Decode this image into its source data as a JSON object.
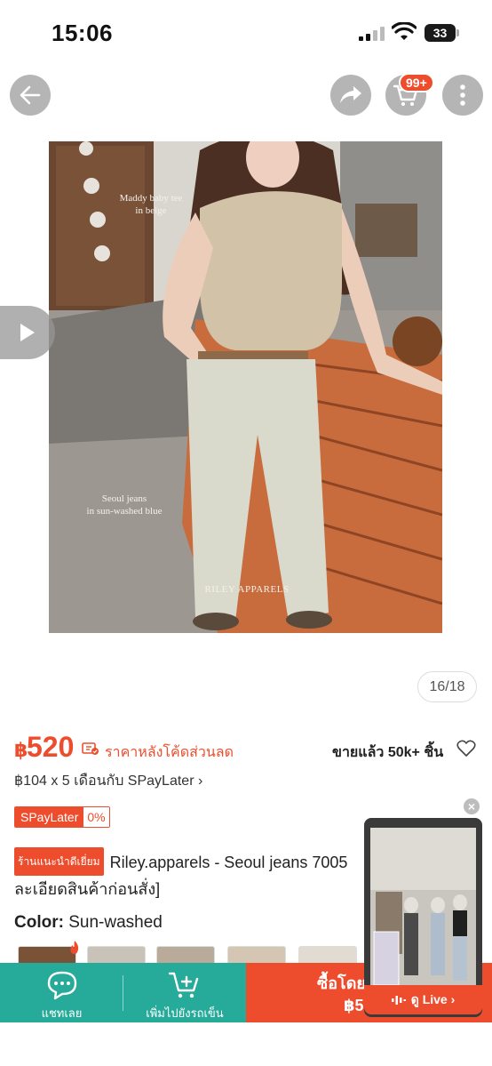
{
  "status_bar": {
    "time": "15:06",
    "battery": "33"
  },
  "header": {
    "cart_badge": "99+"
  },
  "product_image": {
    "caption_top_1": "Maddy baby tee",
    "caption_top_2": "in beige",
    "caption_mid_1": "Seoul jeans",
    "caption_mid_2": "in sun-washed blue",
    "watermark": "RILEY APPARELS",
    "counter": "16/18"
  },
  "price": {
    "currency": "฿",
    "value": "520",
    "note": "ราคาหลังโค้ดส่วนลด",
    "sold": "ขายแล้ว 50k+ ชิ้น",
    "installment": "฿104 x 5 เดือนกับ SPayLater ›"
  },
  "spaylater_tag": {
    "label": "SPayLater",
    "rate": "0%"
  },
  "title": {
    "shop_badge": "ร้านแนะนำดีเยี่ยม",
    "text": "Riley.apparels - Seoul jeans 7005 ละเอียดสินค้าก่อนสั่ง]"
  },
  "variation": {
    "label": "Color:",
    "value": "Sun-washed"
  },
  "bottom_bar": {
    "chat_label": "แชทเลย",
    "add_to_cart_label": "เพิ่มไปยังรถเข็น",
    "buy_label": "ซื้อโดย",
    "buy_price": "฿52"
  },
  "live": {
    "label": "ดู Live ›"
  },
  "colors": {
    "brand": "#ee4d2d",
    "teal": "#26aa99"
  }
}
